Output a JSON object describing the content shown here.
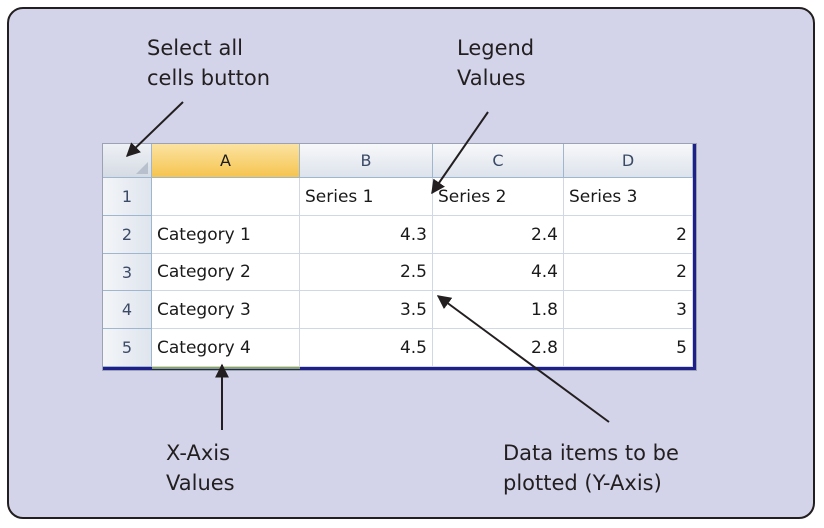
{
  "callouts": {
    "select_all_line1": "Select all",
    "select_all_line2": "cells button",
    "legend_line1": "Legend",
    "legend_line2": "Values",
    "xaxis_line1": "X-Axis",
    "xaxis_line2": "Values",
    "data_line1": "Data items to be",
    "data_line2": "plotted (Y-Axis)"
  },
  "spreadsheet": {
    "columns": [
      "A",
      "B",
      "C",
      "D"
    ],
    "active_column": "A",
    "rows": [
      {
        "row": "1",
        "cells": [
          "",
          "Series 1",
          "Series 2",
          "Series 3"
        ]
      },
      {
        "row": "2",
        "cells": [
          "Category 1",
          "4.3",
          "2.4",
          "2"
        ]
      },
      {
        "row": "3",
        "cells": [
          "Category 2",
          "2.5",
          "4.4",
          "2"
        ]
      },
      {
        "row": "4",
        "cells": [
          "Category 3",
          "3.5",
          "1.8",
          "3"
        ]
      },
      {
        "row": "5",
        "cells": [
          "Category 4",
          "4.5",
          "2.8",
          "5"
        ]
      }
    ]
  },
  "colors": {
    "panel_background": "#d3d4ea",
    "active_header": "#f6c44f",
    "range_border": "#1f1f8a"
  }
}
